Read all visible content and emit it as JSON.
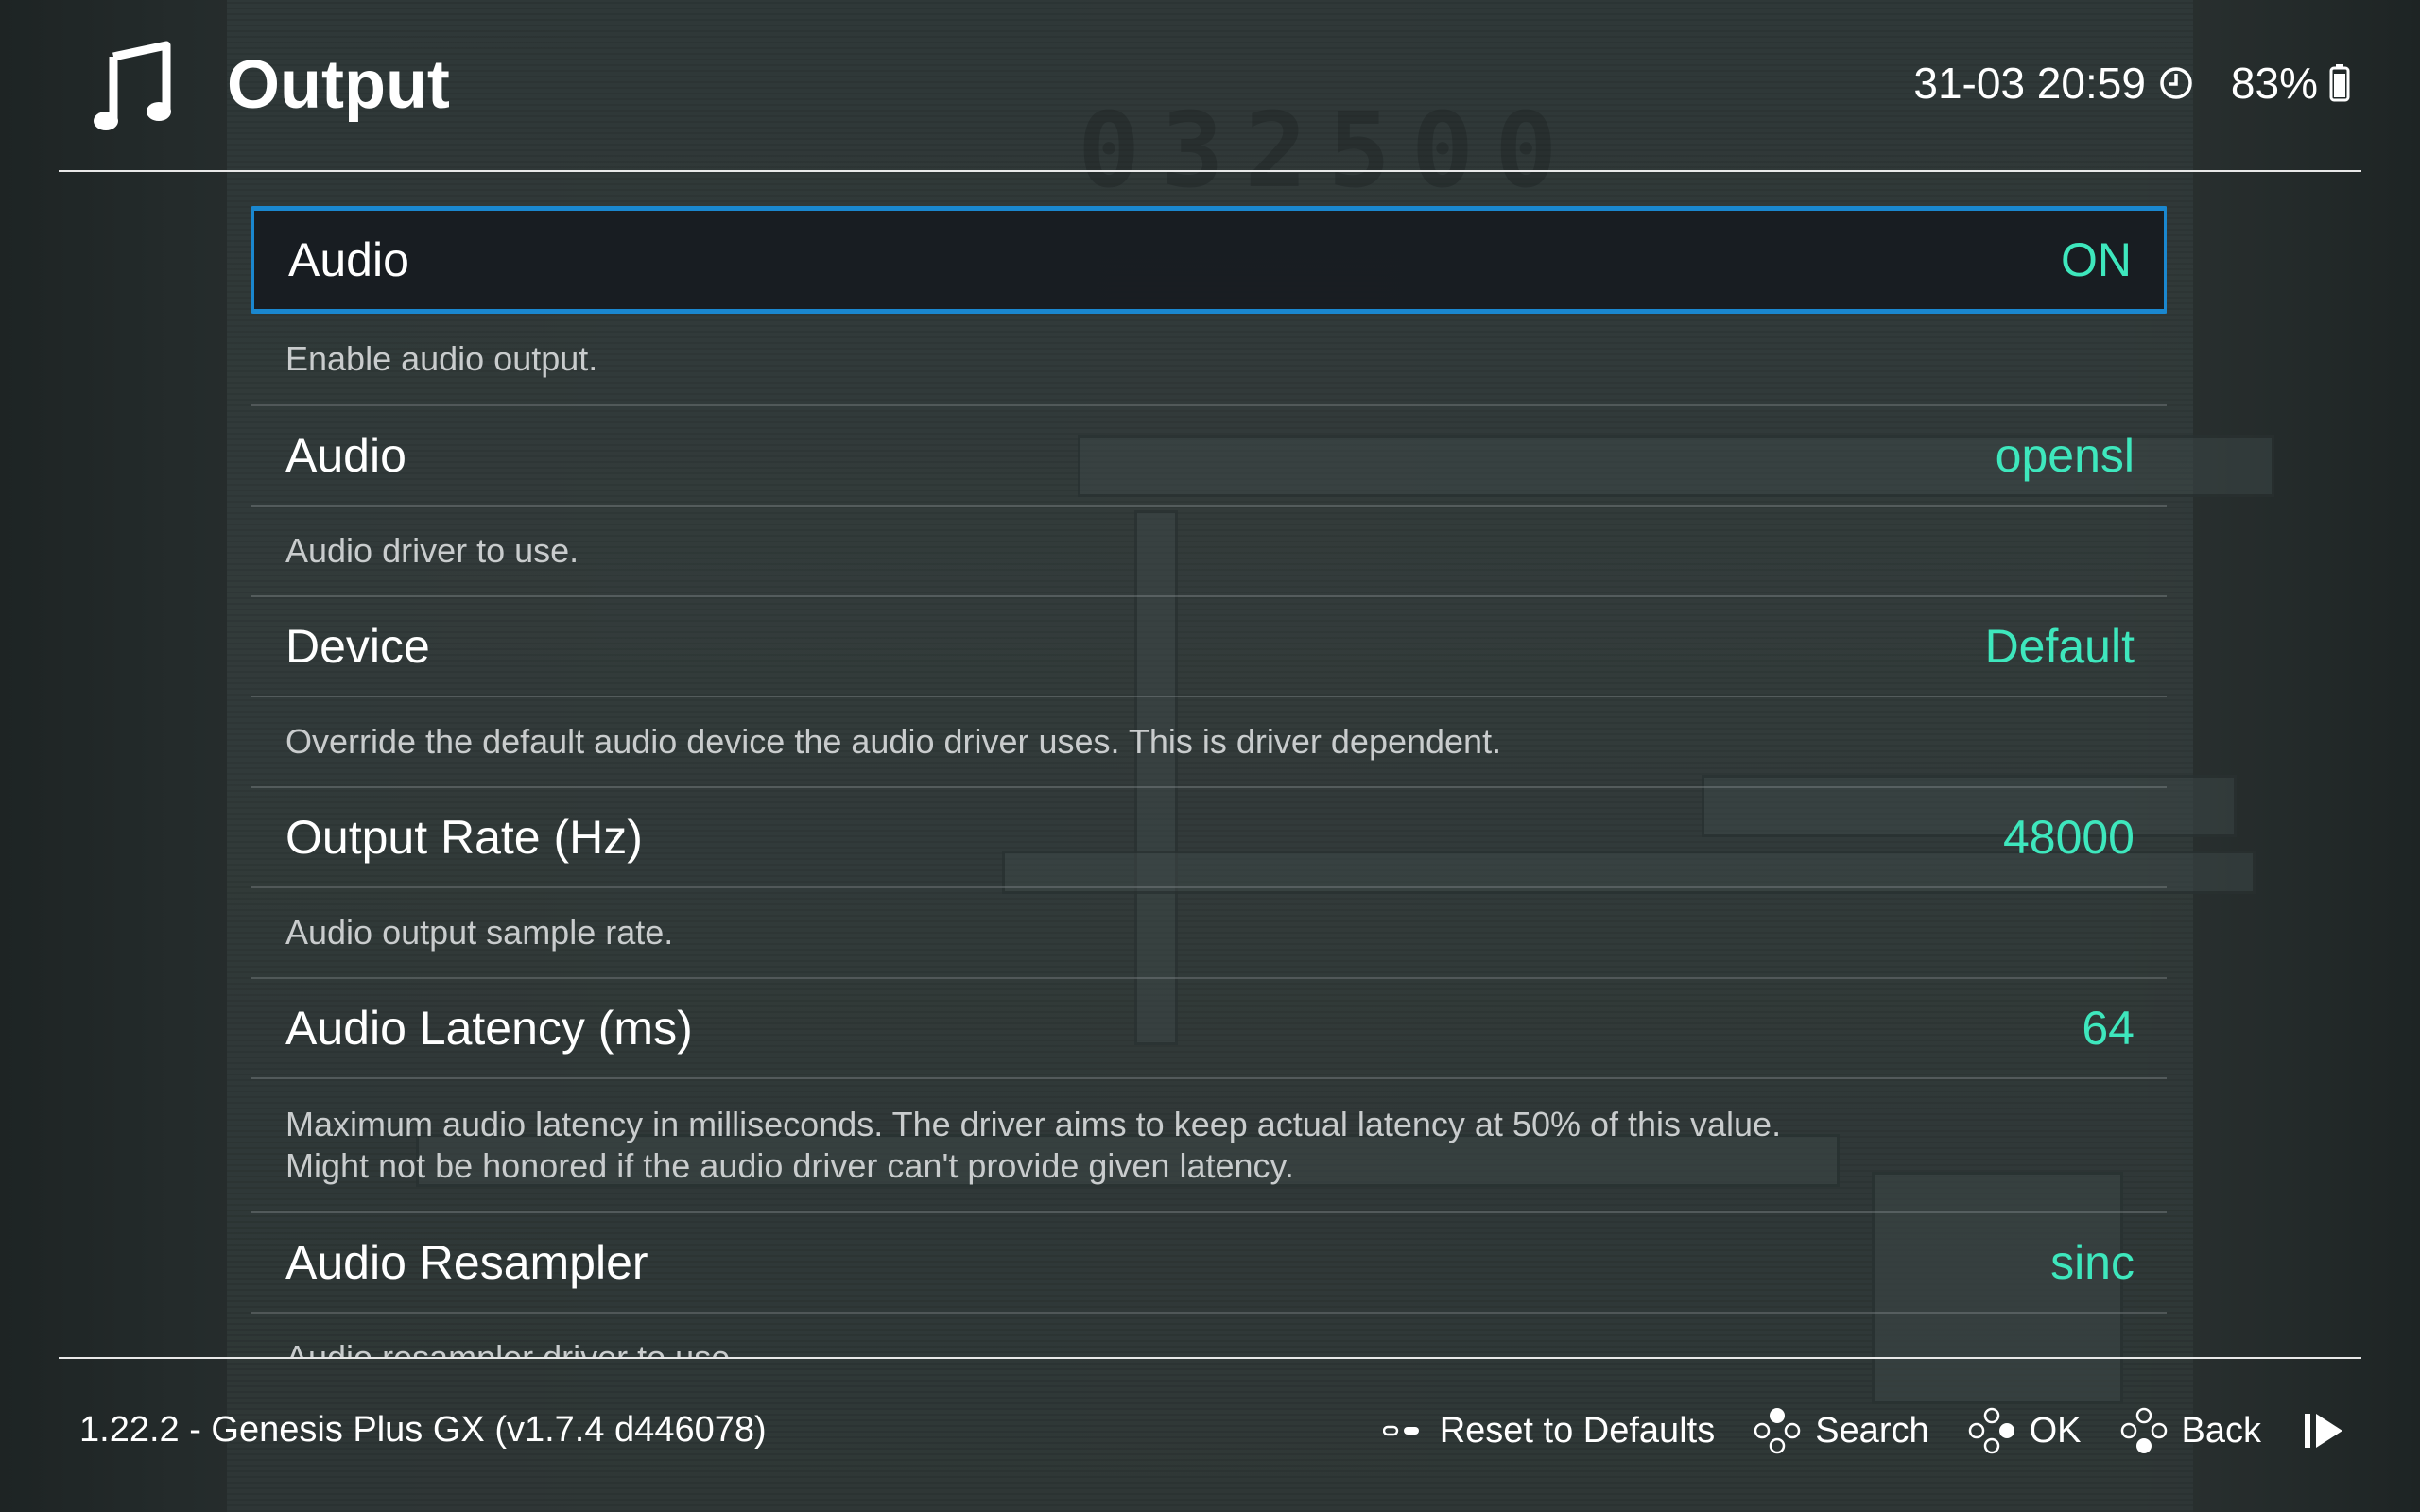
{
  "header": {
    "title": "Output",
    "icon": "music-note-icon",
    "datetime": "31-03 20:59",
    "battery": "83%"
  },
  "settings": [
    {
      "label": "Audio",
      "value": "ON",
      "description": "Enable audio output."
    },
    {
      "label": "Audio",
      "value": "opensl",
      "description": "Audio driver to use."
    },
    {
      "label": "Device",
      "value": "Default",
      "description": "Override the default audio device the audio driver uses. This is driver dependent."
    },
    {
      "label": "Output Rate (Hz)",
      "value": "48000",
      "description": "Audio output sample rate."
    },
    {
      "label": "Audio Latency (ms)",
      "value": "64",
      "description": "Maximum audio latency in milliseconds. The driver aims to keep actual latency at 50% of this value. Might not be honored if the audio driver can't provide given latency."
    },
    {
      "label": "Audio Resampler",
      "value": "sinc",
      "description": "Audio resampler driver to use."
    }
  ],
  "footer": {
    "version": "1.22.2 - Genesis Plus GX (v1.7.4 d446078)",
    "actions": {
      "reset": "Reset to Defaults",
      "search": "Search",
      "ok": "OK",
      "back": "Back"
    }
  },
  "game_backdrop": {
    "score": "032500"
  },
  "colors": {
    "accent_value": "#3ee7bd",
    "selection_border": "#1a87cf",
    "selection_bg": "#16181f",
    "text": "#ffffff",
    "description": "#c9cccd"
  }
}
